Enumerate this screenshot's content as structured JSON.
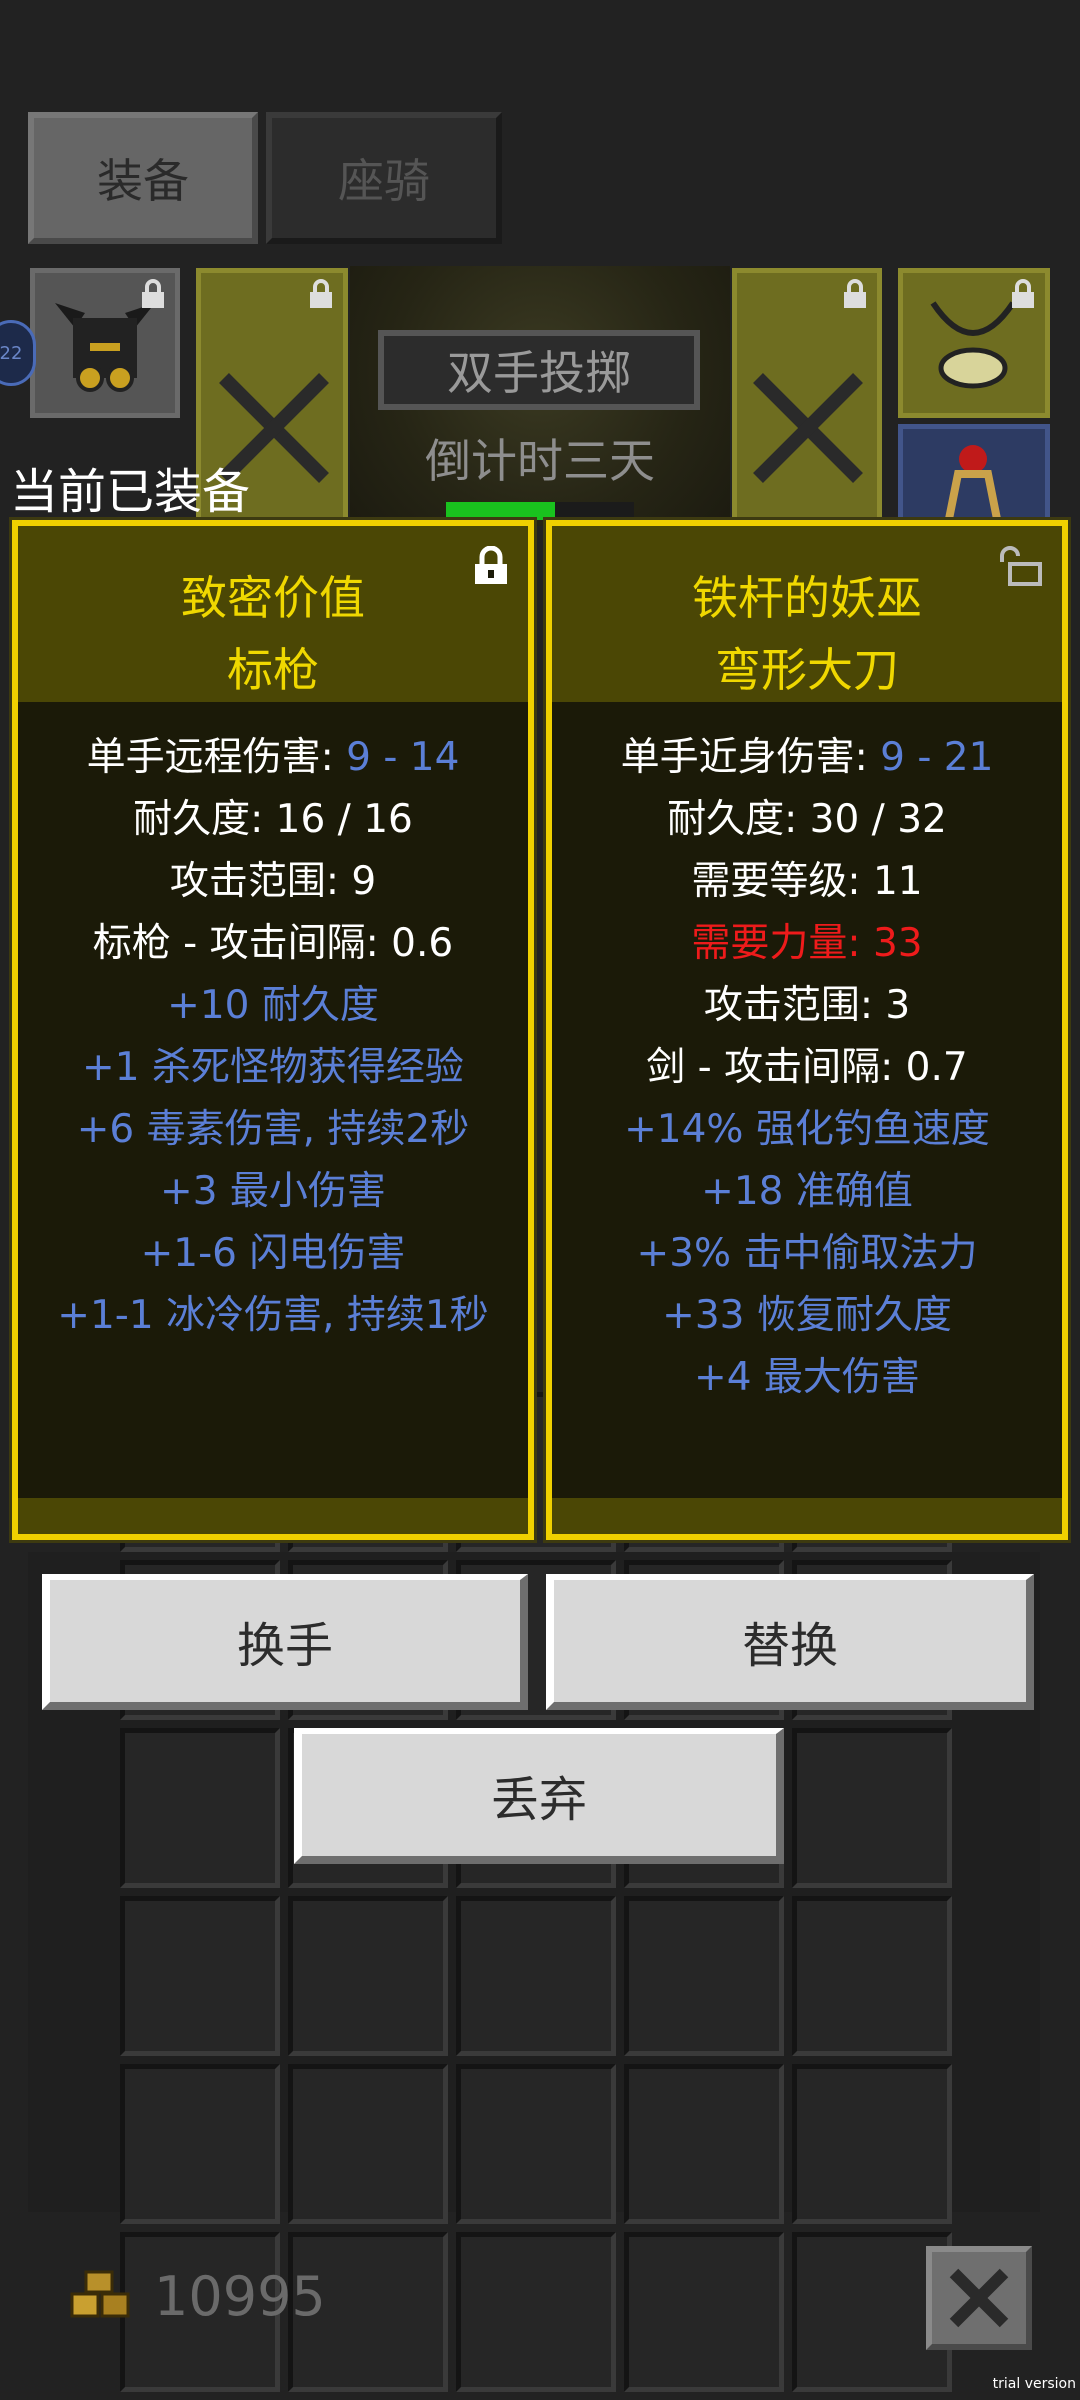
{
  "tabs": [
    {
      "label": "装备",
      "active": true
    },
    {
      "label": "座骑",
      "active": false
    }
  ],
  "preview": {
    "stance_label": "双手投掷",
    "countdown": "倒计时三天",
    "countdown_progress": 0.58,
    "level_badge": "22"
  },
  "equipped_label": "当前已装备",
  "left_item": {
    "name_line1": "致密价值",
    "name_line2": "标枪",
    "locked": true,
    "stats": [
      {
        "text": "单手远程伤害: ",
        "value": "9 - 14",
        "style": "mixed"
      },
      {
        "text": "耐久度: 16 / 16",
        "style": "white"
      },
      {
        "text": "攻击范围: 9",
        "style": "white"
      },
      {
        "text": "标枪 - 攻击间隔: 0.6",
        "style": "white"
      },
      {
        "text": "+10 耐久度",
        "style": "blue"
      },
      {
        "text": "+1 杀死怪物获得经验",
        "style": "blue"
      },
      {
        "text": "+6 毒素伤害, 持续2秒",
        "style": "blue"
      },
      {
        "text": "+3 最小伤害",
        "style": "blue"
      },
      {
        "text": "+1-6 闪电伤害",
        "style": "blue"
      },
      {
        "text": "+1-1 冰冷伤害, 持续1秒",
        "style": "blue"
      }
    ]
  },
  "right_item": {
    "name_line1": "铁杆的妖巫",
    "name_line2": "弯形大刀",
    "locked": false,
    "stats": [
      {
        "text": "单手近身伤害: ",
        "value": "9 - 21",
        "style": "mixed"
      },
      {
        "text": "耐久度: 30 / 32",
        "style": "white"
      },
      {
        "text": "需要等级: 11",
        "style": "white"
      },
      {
        "text": "需要力量: 33",
        "style": "red"
      },
      {
        "text": "攻击范围: 3",
        "style": "white"
      },
      {
        "text": "剑 - 攻击间隔: 0.7",
        "style": "white"
      },
      {
        "text": "+14% 强化钓鱼速度",
        "style": "blue"
      },
      {
        "text": "+18 准确值",
        "style": "blue"
      },
      {
        "text": "+3% 击中偷取法力",
        "style": "blue"
      },
      {
        "text": "+33 恢复耐久度",
        "style": "blue"
      },
      {
        "text": "+4 最大伤害",
        "style": "blue"
      }
    ]
  },
  "actions": {
    "swap_hand": "换手",
    "replace": "替换",
    "discard": "丢弃"
  },
  "gold": "10995",
  "watermark": "trial version",
  "colors": {
    "panel_border": "#f0d000",
    "title": "#f0d800",
    "affix_blue": "#5b7fd6",
    "requirement_red": "#ee1b1b",
    "countdown_green": "#19c21e"
  }
}
